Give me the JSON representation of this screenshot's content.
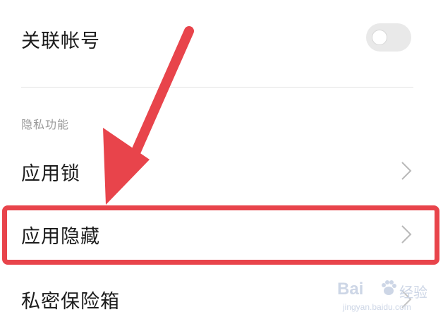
{
  "settings": {
    "linked_account": {
      "label": "关联帐号",
      "toggle_on": false
    },
    "section_title": "隐私功能",
    "items": [
      {
        "label": "应用锁"
      },
      {
        "label": "应用隐藏"
      },
      {
        "label": "私密保险箱"
      }
    ]
  },
  "annotation": {
    "color": "#e8444b",
    "highlighted_item": "应用隐藏"
  },
  "watermark": {
    "brand": "Bai",
    "suffix": "经验",
    "url": "jingyan.baidu.com"
  },
  "icons": {
    "chevron": "chevron-right-icon",
    "toggle": "toggle-switch"
  }
}
